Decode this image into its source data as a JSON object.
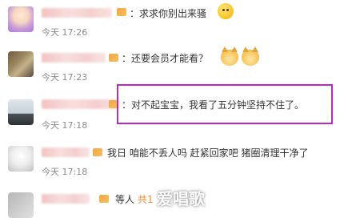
{
  "comments": [
    {
      "message": "：求求你别出来骚",
      "time": "今天 17:26"
    },
    {
      "message": "：还要会员才能看？",
      "time": "今天 17:23"
    },
    {
      "message": "：对不起宝宝，我看了五分钟坚持不住了。",
      "time": "今天 17:18"
    },
    {
      "message": "我日 咱能不丢人吗 赶紧回家吧 猪圈清理干净了",
      "time": "今天 17:18"
    },
    {
      "message": "等人",
      "extra": "共1"
    }
  ],
  "watermark": "爱唱歌",
  "colors": {
    "highlight": "#c026c5",
    "time": "#8a8a8a",
    "vip": "#f2a444"
  },
  "icons": [
    "smiley-emoji-icon",
    "cat-emoji-icon",
    "vip-badge-icon"
  ]
}
